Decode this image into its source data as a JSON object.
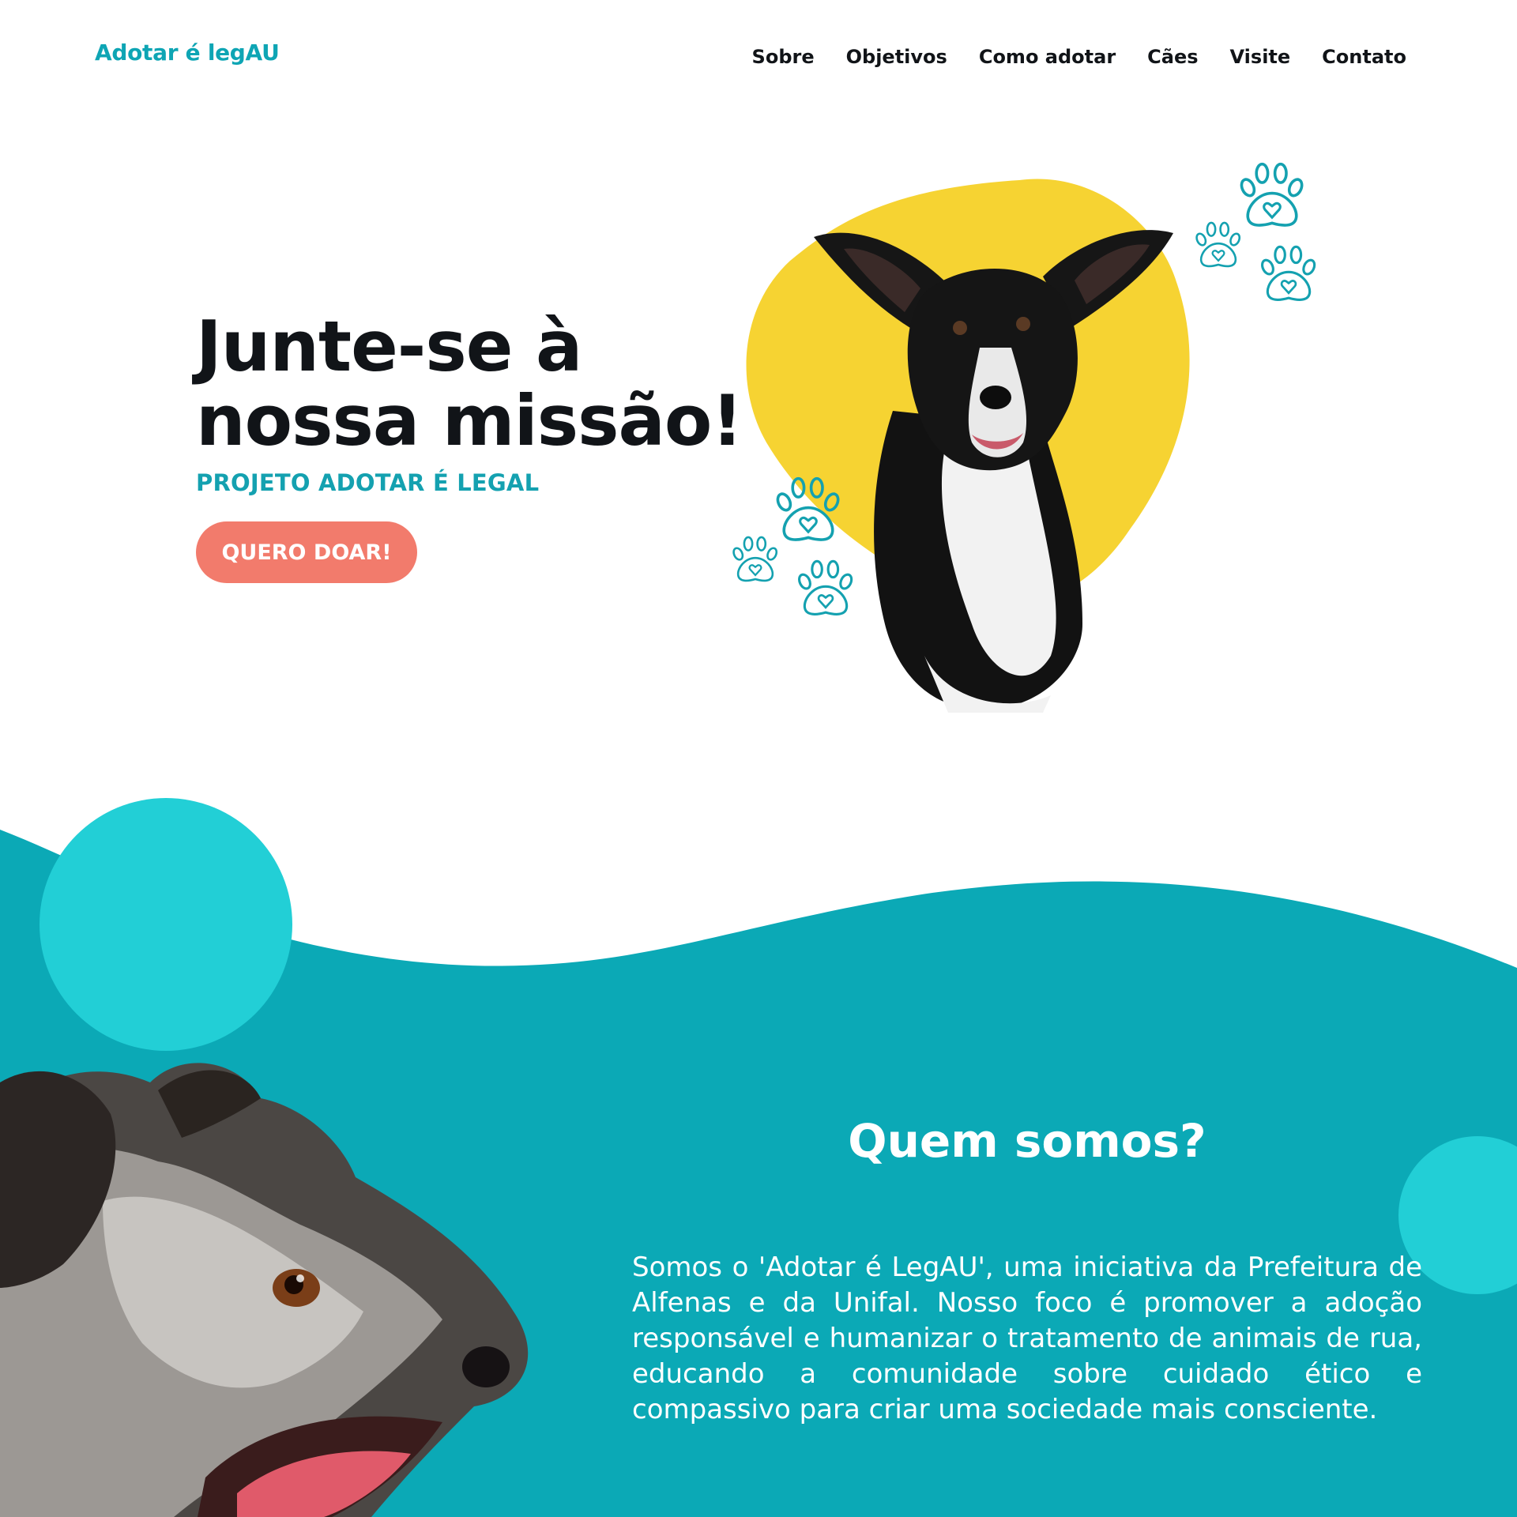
{
  "header": {
    "logo": "Adotar é legAU",
    "nav": [
      "Sobre",
      "Objetivos",
      "Como adotar",
      "Cães",
      "Visite",
      "Contato"
    ]
  },
  "hero": {
    "title_line1": "Junte-se à",
    "title_line2": "nossa missão!",
    "subtitle": "PROJETO ADOTAR É LEGAL",
    "cta": "QUERO DOAR!"
  },
  "about": {
    "title": "Quem somos?",
    "text": "Somos o 'Adotar é LegAU', uma iniciativa da Prefeitura de Alfenas e da Unifal. Nosso foco é promover a adoção responsável e humanizar o tratamento de animais de rua, educando a comunidade sobre cuidado ético e compassivo para criar uma sociedade mais consciente."
  },
  "colors": {
    "accent": "#0ea5b4",
    "section_bg": "#0ba9b6",
    "circle": "#22cfd6",
    "blob": "#f6d332",
    "cta": "#f27b6c"
  },
  "icons": [
    "paw-heart-icon"
  ]
}
